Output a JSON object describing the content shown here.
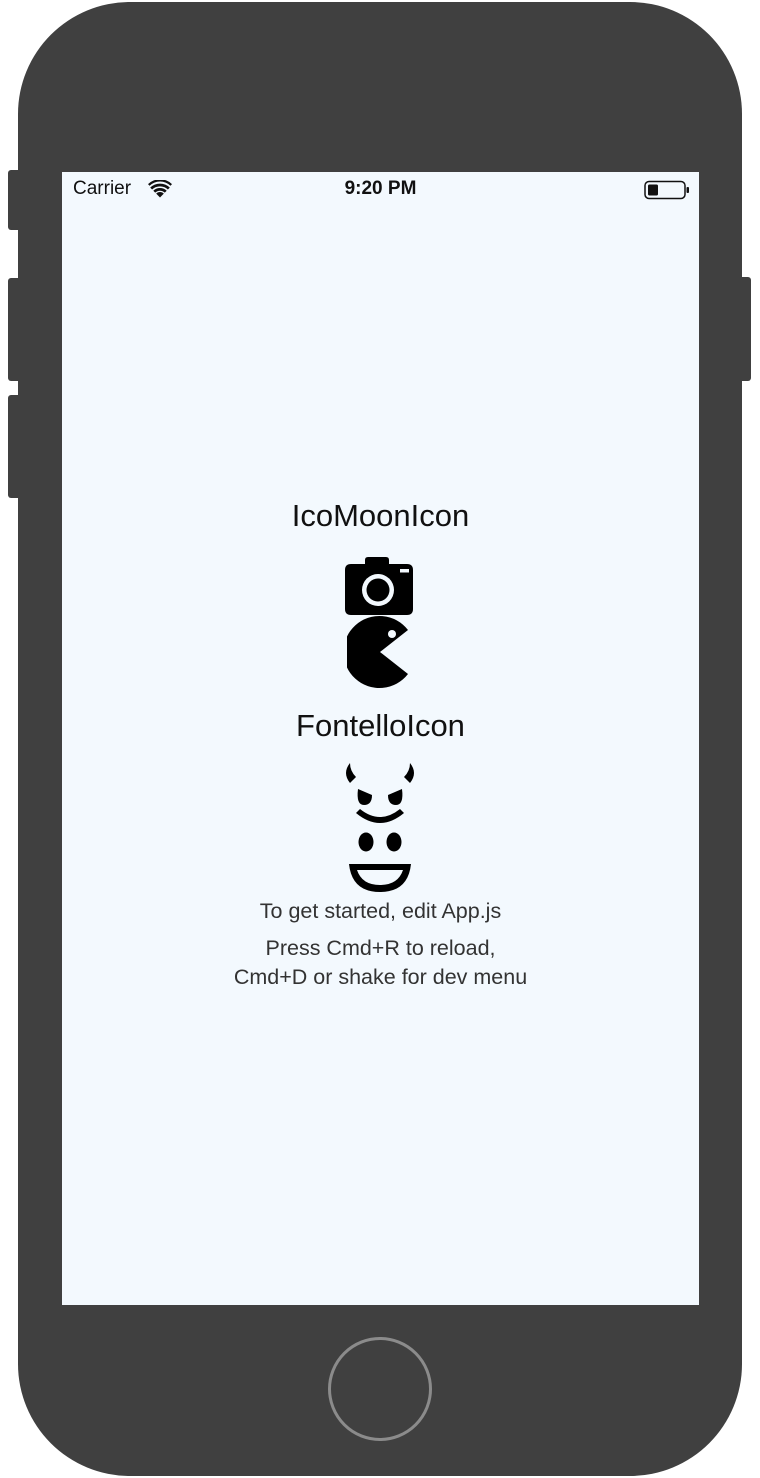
{
  "status_bar": {
    "carrier": "Carrier",
    "time": "9:20 PM",
    "wifi_icon": "wifi-icon",
    "battery_icon": "battery-icon",
    "battery_level": 0.3
  },
  "main": {
    "icomoon_title": "IcoMoonIcon",
    "icomoon_icons": [
      "camera-icon",
      "pacman-icon"
    ],
    "fontello_title": "FontelloIcon",
    "fontello_icons": [
      "devil-face-icon",
      "smiley-face-icon"
    ],
    "instructions": "To get started, edit App.js",
    "reload_line1": "Press Cmd+R to reload,",
    "reload_line2": "Cmd+D or shake for dev menu"
  },
  "colors": {
    "device": "#404040",
    "screen_background": "#f3f9fe",
    "icon": "#000000",
    "home_ring": "#8b8b8b"
  }
}
